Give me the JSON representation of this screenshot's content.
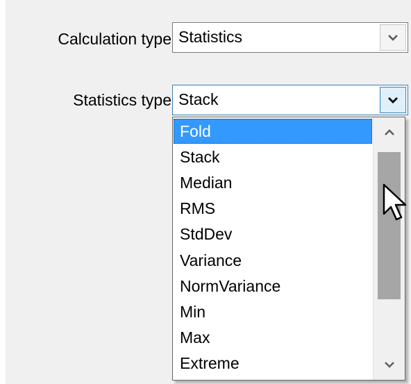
{
  "form": {
    "calculation_type": {
      "label": "Calculation type",
      "value": "Statistics",
      "arrow_icon": "chevron-down-icon"
    },
    "statistics_type": {
      "label": "Statistics type",
      "value": "Stack",
      "arrow_icon": "chevron-down-icon",
      "options": [
        "Fold",
        "Stack",
        "Median",
        "RMS",
        "StdDev",
        "Variance",
        "NormVariance",
        "Min",
        "Max",
        "Extreme"
      ],
      "highlighted_option": "Fold"
    }
  },
  "colors": {
    "panel_background": "#f0f0f0",
    "selection": "#3399ff",
    "scroll_thumb": "#a6a6a6",
    "focus_border": "#3c7fb1"
  }
}
